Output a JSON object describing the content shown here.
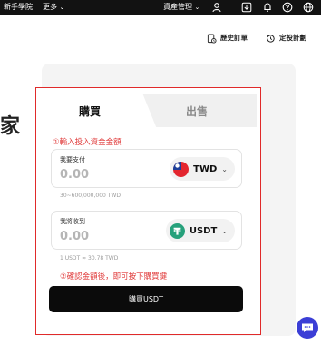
{
  "topbar": {
    "academy": "新手學院",
    "more": "更多",
    "more_chevron": "⌄",
    "assets": "資產管理",
    "assets_chevron": "⌄"
  },
  "actions": {
    "history": "歷史訂單",
    "dca": "定投計劃"
  },
  "background_fragment": "家",
  "tabs": {
    "buy": "購買",
    "sell": "出售"
  },
  "annotations": {
    "step1": "①輸入投入資金金額",
    "step2": "②確認金額後，即可按下購買鍵"
  },
  "pay": {
    "label": "我要支付",
    "placeholder": "0.00",
    "currency": "TWD",
    "currency_icon": "taiwan-flag-icon",
    "range": "30~600,000,000 TWD"
  },
  "receive": {
    "label": "我將收到",
    "placeholder": "0.00",
    "currency": "USDT",
    "currency_icon": "tether-icon",
    "rate": "1 USDT ≈ 30.78 TWD"
  },
  "buy_button": "購買USDT",
  "colors": {
    "annotation_red": "#e02a2a",
    "tether_green": "#26a17b",
    "chat_blue": "#3b3ed6",
    "button_black": "#0b0b0b"
  }
}
